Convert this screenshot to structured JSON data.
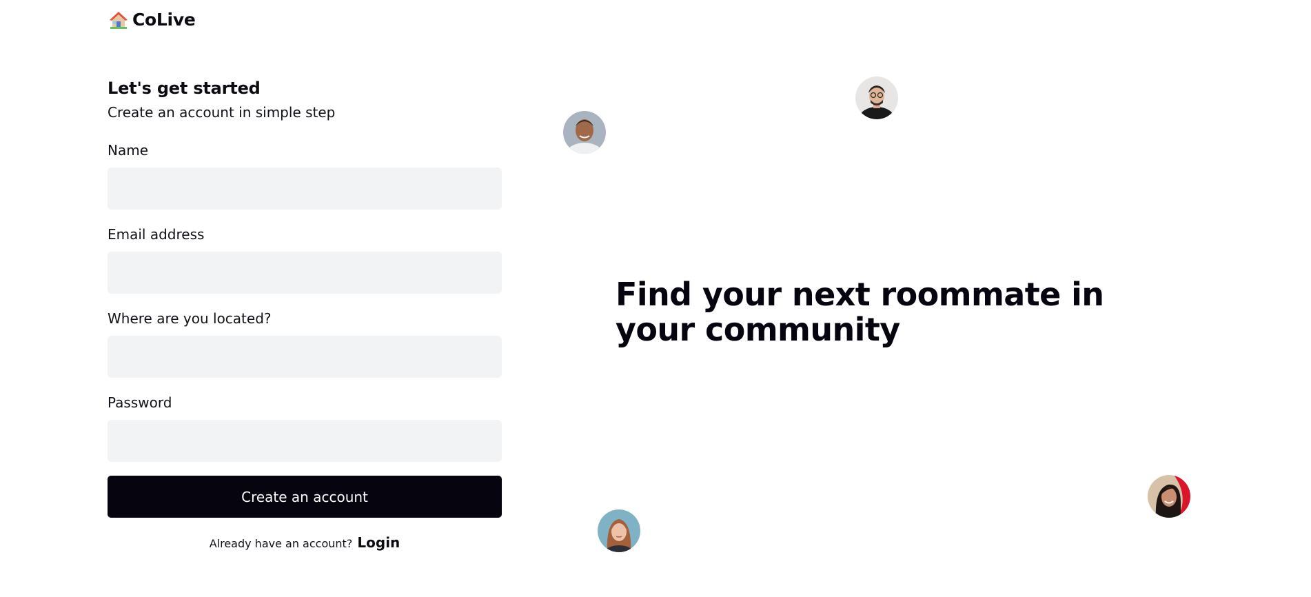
{
  "brand": {
    "name": "CoLive",
    "icon": "house-icon"
  },
  "form": {
    "title": "Let's get started",
    "subtitle": "Create an account in simple step",
    "fields": {
      "name": {
        "label": "Name",
        "value": "",
        "placeholder": ""
      },
      "email": {
        "label": "Email address",
        "value": "",
        "placeholder": ""
      },
      "location": {
        "label": "Where are you located?",
        "value": "",
        "placeholder": ""
      },
      "password": {
        "label": "Password",
        "value": "",
        "placeholder": ""
      }
    },
    "submit_label": "Create an account",
    "login_prompt": "Already have an account?",
    "login_link": "Login"
  },
  "hero": {
    "headline": "Find your next roommate in your community"
  },
  "colors": {
    "primary": "#05040f",
    "input_bg": "#f2f3f5",
    "background": "#ffffff"
  }
}
